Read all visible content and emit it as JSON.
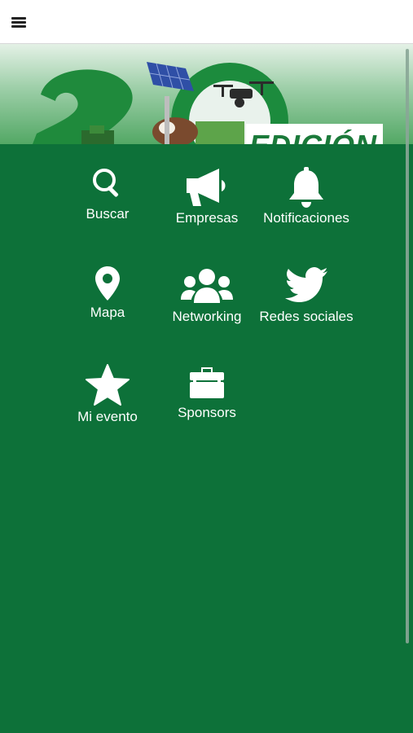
{
  "header": {
    "menu_icon": "hamburger-menu-icon"
  },
  "banner": {
    "edition_text": "EDICIÓN"
  },
  "menu": {
    "items": [
      {
        "label": "Buscar",
        "icon": "search-icon"
      },
      {
        "label": "Empresas",
        "icon": "megaphone-icon"
      },
      {
        "label": "Notificaciones",
        "icon": "bell-icon"
      },
      {
        "label": "Mapa",
        "icon": "map-marker-icon"
      },
      {
        "label": "Networking",
        "icon": "users-icon"
      },
      {
        "label": "Redes sociales",
        "icon": "twitter-icon"
      },
      {
        "label": "Mi evento",
        "icon": "star-icon"
      },
      {
        "label": "Sponsors",
        "icon": "briefcase-icon"
      }
    ]
  },
  "colors": {
    "background": "#0d7139",
    "topbar": "#ffffff",
    "text": "#ffffff"
  }
}
